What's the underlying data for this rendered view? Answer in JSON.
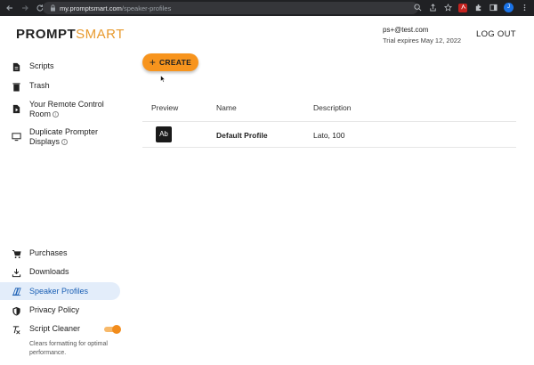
{
  "browser": {
    "url_host": "my.promptsmart.com",
    "url_path": "/speaker-profiles",
    "profile_initial": "J"
  },
  "header": {
    "logo_part1": "PROMPT",
    "logo_part2": "SMART",
    "email": "ps+@test.com",
    "trial": "Trial expires May 12, 2022",
    "logout": "LOG OUT"
  },
  "sidebar": {
    "items": [
      {
        "label": "Scripts",
        "icon": "document-icon"
      },
      {
        "label": "Trash",
        "icon": "trash-icon"
      },
      {
        "label": "Your Remote Control Room",
        "icon": "remote-icon"
      },
      {
        "label": "Duplicate Prompter Displays",
        "icon": "monitor-icon"
      },
      {
        "label": "Purchases",
        "icon": "cart-icon"
      },
      {
        "label": "Downloads",
        "icon": "download-icon"
      },
      {
        "label": "Speaker Profiles",
        "icon": "speaker-icon"
      },
      {
        "label": "Privacy Policy",
        "icon": "shield-icon"
      },
      {
        "label": "Script Cleaner",
        "icon": "clear-format-icon"
      }
    ],
    "info_symbol": "i",
    "script_cleaner_note": "Clears formatting for optimal performance.",
    "script_cleaner_on": true
  },
  "main": {
    "create_symbol": "+",
    "create_label": "CREATE",
    "table": {
      "headers": [
        "Preview",
        "Name",
        "Description"
      ],
      "rows": [
        {
          "preview": "Ab",
          "name": "Default Profile",
          "description": "Lato, 100"
        }
      ]
    }
  },
  "colors": {
    "accent": "#f7941d",
    "active_bg": "#e3edfa",
    "active_text": "#1a5fb4"
  }
}
